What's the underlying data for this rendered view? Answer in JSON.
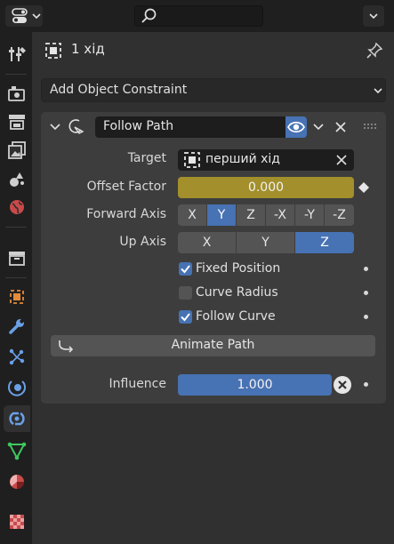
{
  "header": {
    "editor_icon": "properties-editor-icon",
    "search_icon": "search-icon",
    "options_icon": "chevron-down-icon"
  },
  "tabs": [
    {
      "name": "tool",
      "icon": "tool-icon"
    },
    {
      "name": "render",
      "icon": "render-icon"
    },
    {
      "name": "output",
      "icon": "output-icon"
    },
    {
      "name": "view-layer",
      "icon": "view-layer-icon"
    },
    {
      "name": "scene",
      "icon": "scene-icon"
    },
    {
      "name": "world",
      "icon": "world-icon"
    },
    {
      "name": "collection",
      "icon": "collection-icon"
    },
    {
      "name": "object",
      "icon": "object-icon"
    },
    {
      "name": "modifiers",
      "icon": "wrench-icon"
    },
    {
      "name": "particles",
      "icon": "particles-icon"
    },
    {
      "name": "physics",
      "icon": "physics-icon"
    },
    {
      "name": "object-constraints",
      "icon": "constraint-icon",
      "active": true
    },
    {
      "name": "object-data",
      "icon": "mesh-data-icon"
    },
    {
      "name": "material",
      "icon": "material-icon"
    },
    {
      "name": "texture",
      "icon": "texture-icon"
    }
  ],
  "object": {
    "name": "1 хід",
    "pin_icon": "pin-icon"
  },
  "add_constraint": {
    "label": "Add Object Constraint"
  },
  "constraint": {
    "name": "Follow Path",
    "visible": true,
    "target_label": "Target",
    "target_value": "перший хід",
    "offset_label": "Offset Factor",
    "offset_value": "0.000",
    "forward_label": "Forward Axis",
    "forward_options": [
      "X",
      "Y",
      "Z",
      "-X",
      "-Y",
      "-Z"
    ],
    "forward_selected": "Y",
    "up_label": "Up Axis",
    "up_options": [
      "X",
      "Y",
      "Z"
    ],
    "up_selected": "Z",
    "fixed_position_label": "Fixed Position",
    "fixed_position": true,
    "curve_radius_label": "Curve Radius",
    "curve_radius": false,
    "follow_curve_label": "Follow Curve",
    "follow_curve": true,
    "animate_label": "Animate Path",
    "influence_label": "Influence",
    "influence_value": "1.000",
    "influence": 1.0
  },
  "colors": {
    "accent": "#4772b3",
    "keyed": "#a38f2b",
    "panel": "#3d3d3d",
    "background": "#303030"
  }
}
